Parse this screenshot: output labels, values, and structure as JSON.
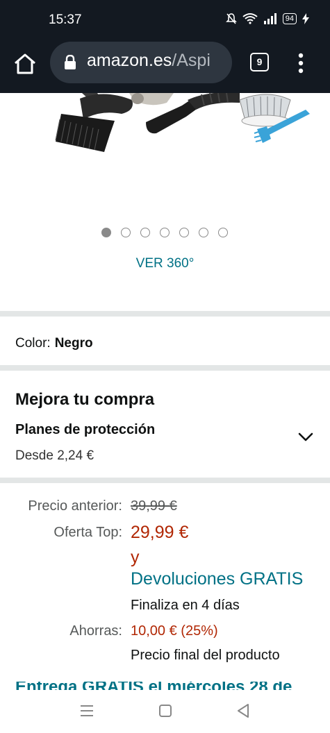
{
  "status": {
    "time": "15:37",
    "battery": "94"
  },
  "browser": {
    "domain": "amazon.es",
    "path": "/Aspi",
    "tab_count": "9"
  },
  "gallery": {
    "dot_count": 7,
    "active_index": 0,
    "view360_label": "VER 360°"
  },
  "color": {
    "label": "Color:",
    "value": "Negro"
  },
  "upsell": {
    "title": "Mejora tu compra",
    "plan_title": "Planes de protección",
    "plan_price": "Desde 2,24 €"
  },
  "pricing": {
    "previous_label": "Precio anterior:",
    "previous_value": "39,99 €",
    "deal_label": "Oferta Top:",
    "deal_value": "29,99 €",
    "and": "y",
    "returns_link": "Devoluciones GRATIS",
    "ends": "Finaliza en 4 días",
    "savings_label": "Ahorras:",
    "savings_value": "10,00 € (25%)",
    "final_note": "Precio final del producto"
  },
  "delivery_partial": "Entrega GRATIS el miércoles 28 de"
}
